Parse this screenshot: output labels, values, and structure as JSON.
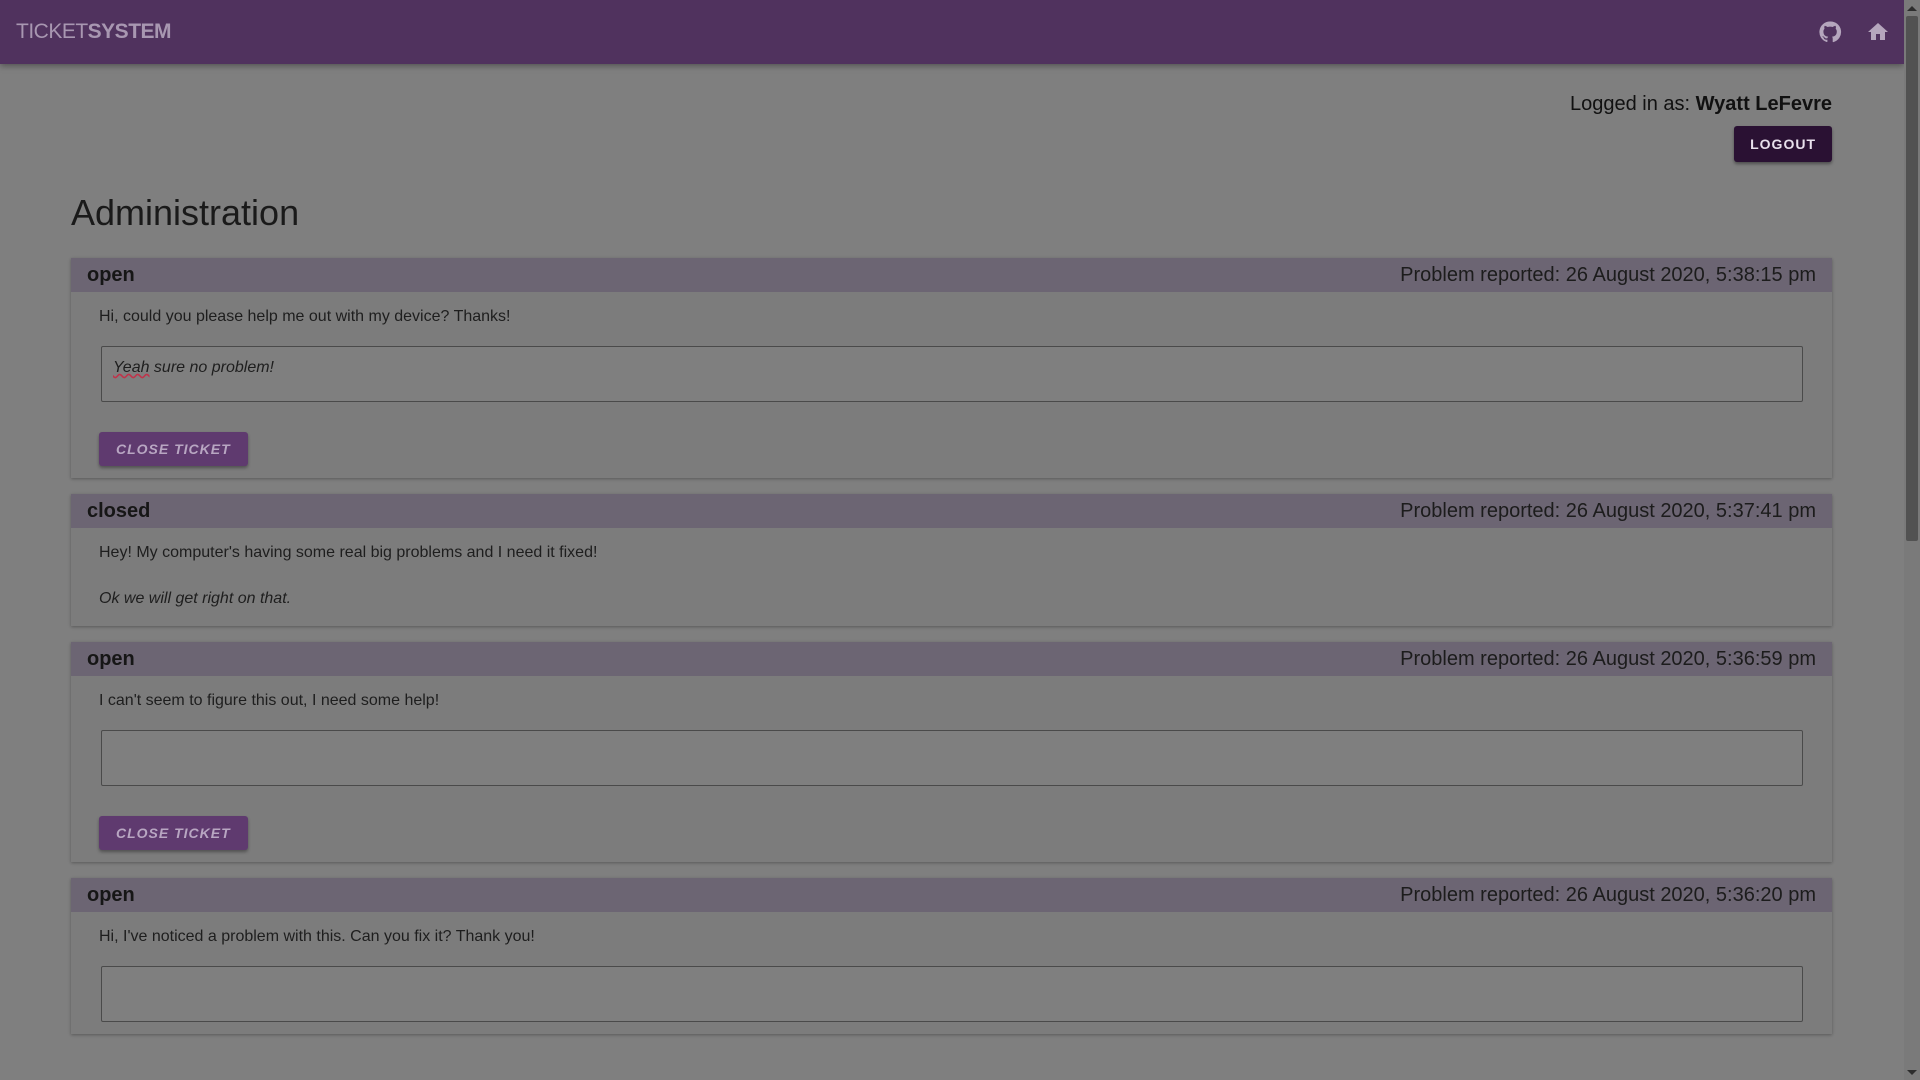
{
  "navbar": {
    "brand_part1": "TICKET",
    "brand_part2": "SYSTEM",
    "icons": [
      "github-icon",
      "home-icon"
    ]
  },
  "user": {
    "logged_in_prefix": "Logged in as:",
    "name": "Wyatt LeFevre",
    "logout_label": "LOGOUT"
  },
  "page": {
    "title": "Administration"
  },
  "tickets": [
    {
      "status": "open",
      "reported": "Problem reported: 26 August 2020, 5:38:15 pm",
      "message": "Hi, could you please help me out with my device? Thanks!",
      "reply_value_word1": "Yeah",
      "reply_value_rest": " sure no problem!",
      "close_label": "CLOSE TICKET"
    },
    {
      "status": "closed",
      "reported": "Problem reported: 26 August 2020, 5:37:41 pm",
      "message": "Hey! My computer's having some real big problems and I need it fixed!",
      "reply": "Ok we will get right on that."
    },
    {
      "status": "open",
      "reported": "Problem reported: 26 August 2020, 5:36:59 pm",
      "message": "I can't seem to figure this out, I need some help!",
      "reply_value": "",
      "close_label": "CLOSE TICKET"
    },
    {
      "status": "open",
      "reported": "Problem reported: 26 August 2020, 5:36:20 pm",
      "message": "Hi, I've noticed a problem with this. Can you fix it? Thank you!",
      "reply_value": ""
    }
  ],
  "colors": {
    "navbar": "#50325e",
    "logout_button": "#2a1133",
    "close_button": "#5f3a6f",
    "ticket_header": "#6c6573",
    "overlay_background": "#7f7f7f"
  }
}
